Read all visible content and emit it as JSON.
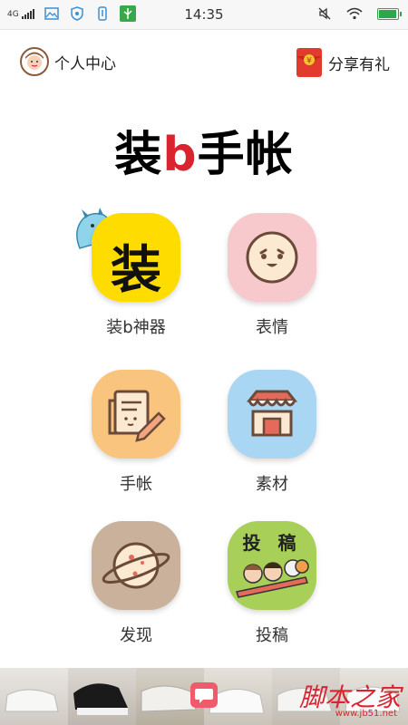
{
  "status_bar": {
    "network": "4G",
    "time": "14:35"
  },
  "header": {
    "profile_label": "个人中心",
    "share_label": "分享有礼"
  },
  "app_title": {
    "part1": "装",
    "part2": "b",
    "part3": "手帐"
  },
  "menu": {
    "items": [
      {
        "label": "装b神器",
        "icon": "zhuang-character-icon",
        "color": "#ffd900"
      },
      {
        "label": "表情",
        "icon": "smiley-face-icon",
        "color": "#f7c8cc"
      },
      {
        "label": "手帐",
        "icon": "notebook-pencil-icon",
        "color": "#f9c47e"
      },
      {
        "label": "素材",
        "icon": "shop-icon",
        "color": "#a9d6f3"
      },
      {
        "label": "发现",
        "icon": "planet-icon",
        "color": "#c9b19c"
      },
      {
        "label": "投稿",
        "icon": "contribute-cartoon-icon",
        "color": "#a8cf57",
        "badge_text": "投 稿"
      }
    ],
    "item1_glyph": "装"
  },
  "watermark": {
    "text": "脚本之家",
    "sub": "www.jb51.net"
  }
}
